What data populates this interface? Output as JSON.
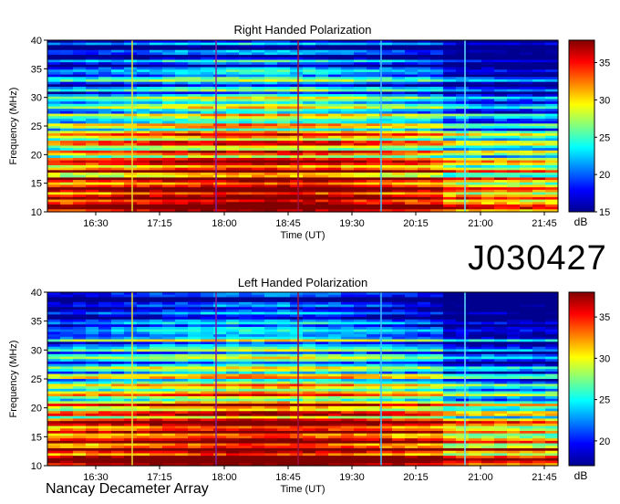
{
  "figure_label": "J030427",
  "footer": "Nancay Decameter Array",
  "colors": {
    "colormap": [
      "#00008f",
      "#0000ff",
      "#0080ff",
      "#00ffff",
      "#80ff80",
      "#ffff00",
      "#ff8000",
      "#ff0000",
      "#800000"
    ]
  },
  "chart_data": [
    {
      "type": "heatmap",
      "title": "Right Handed Polarization",
      "xlabel": "Time (UT)",
      "ylabel": "Frequency (MHz)",
      "x_ticks": [
        "16:30",
        "17:15",
        "18:00",
        "18:45",
        "19:30",
        "20:15",
        "21:00",
        "21:45"
      ],
      "y_ticks": [
        "10",
        "15",
        "20",
        "25",
        "30",
        "35",
        "40"
      ],
      "ylim": [
        10,
        40
      ],
      "colorbar": {
        "label": "dB",
        "ticks": [
          "15",
          "20",
          "25",
          "30",
          "35"
        ],
        "range": [
          15,
          38
        ]
      }
    },
    {
      "type": "heatmap",
      "title": "Left Handed Polarization",
      "xlabel": "Time (UT)",
      "ylabel": "Frequency (MHz)",
      "x_ticks": [
        "16:30",
        "17:15",
        "18:00",
        "18:45",
        "19:30",
        "20:15",
        "21:00",
        "21:45"
      ],
      "y_ticks": [
        "10",
        "15",
        "20",
        "25",
        "30",
        "35",
        "40"
      ],
      "ylim": [
        10,
        40
      ],
      "colorbar": {
        "label": "dB",
        "ticks": [
          "20",
          "25",
          "30",
          "35"
        ],
        "range": [
          17,
          38
        ]
      }
    }
  ]
}
